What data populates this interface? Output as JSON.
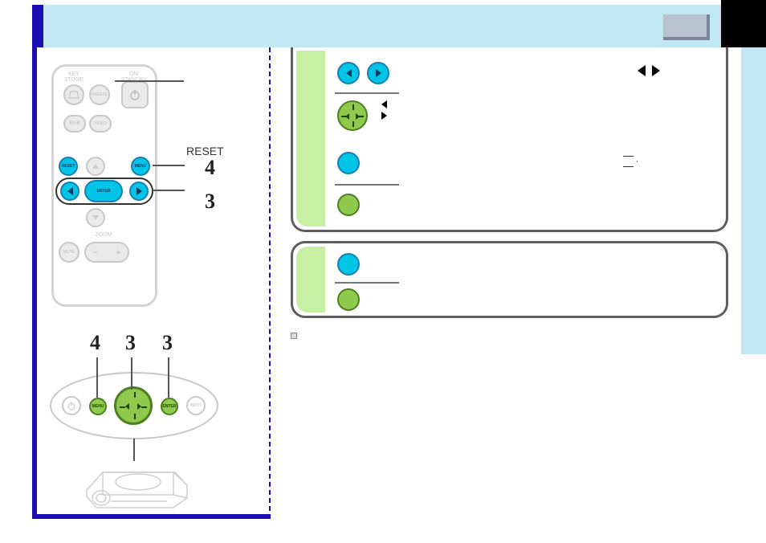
{
  "callouts": {
    "reset": "RESET",
    "num4": "4",
    "num3": "3"
  },
  "panel_nums": [
    "4",
    "3",
    "3"
  ],
  "remote_labels": {
    "keystone": "KEY\nSTONE",
    "freeze": "FREEZE",
    "onstandby": "ON/\nSTANDBY",
    "rgb": "RGB",
    "video": "VIDEO",
    "reset": "RESET",
    "menu": "MENU",
    "enter": "ENTER",
    "mute": "MUTE",
    "zoom": "ZOOM"
  },
  "panel_labels": {
    "menu": "MENU",
    "enter": "ENTER",
    "input": "INPUT"
  }
}
